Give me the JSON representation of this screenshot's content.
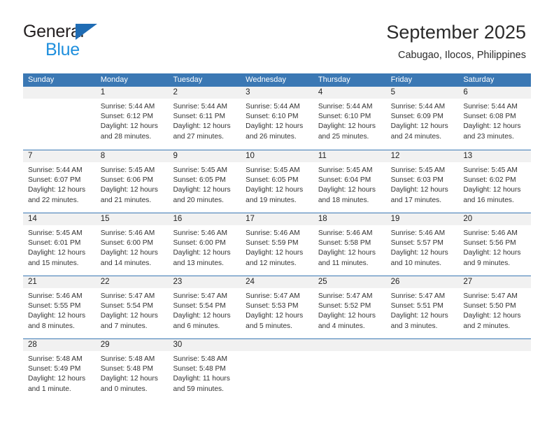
{
  "brand": {
    "name_top": "General",
    "name_bottom": "Blue",
    "triangle_color": "#1f6cb4",
    "blue_color": "#1f8fdd"
  },
  "header": {
    "title": "September 2025",
    "subtitle": "Cabugao, Ilocos, Philippines"
  },
  "theme": {
    "header_blue": "#3b78b4",
    "date_band": "#f1f1f1",
    "text": "#222222"
  },
  "weekdays": [
    "Sunday",
    "Monday",
    "Tuesday",
    "Wednesday",
    "Thursday",
    "Friday",
    "Saturday"
  ],
  "weeks": [
    [
      {
        "empty": true
      },
      {
        "date": "1",
        "sunrise": "Sunrise: 5:44 AM",
        "sunset": "Sunset: 6:12 PM",
        "daylight1": "Daylight: 12 hours",
        "daylight2": "and 28 minutes."
      },
      {
        "date": "2",
        "sunrise": "Sunrise: 5:44 AM",
        "sunset": "Sunset: 6:11 PM",
        "daylight1": "Daylight: 12 hours",
        "daylight2": "and 27 minutes."
      },
      {
        "date": "3",
        "sunrise": "Sunrise: 5:44 AM",
        "sunset": "Sunset: 6:10 PM",
        "daylight1": "Daylight: 12 hours",
        "daylight2": "and 26 minutes."
      },
      {
        "date": "4",
        "sunrise": "Sunrise: 5:44 AM",
        "sunset": "Sunset: 6:10 PM",
        "daylight1": "Daylight: 12 hours",
        "daylight2": "and 25 minutes."
      },
      {
        "date": "5",
        "sunrise": "Sunrise: 5:44 AM",
        "sunset": "Sunset: 6:09 PM",
        "daylight1": "Daylight: 12 hours",
        "daylight2": "and 24 minutes."
      },
      {
        "date": "6",
        "sunrise": "Sunrise: 5:44 AM",
        "sunset": "Sunset: 6:08 PM",
        "daylight1": "Daylight: 12 hours",
        "daylight2": "and 23 minutes."
      }
    ],
    [
      {
        "date": "7",
        "sunrise": "Sunrise: 5:44 AM",
        "sunset": "Sunset: 6:07 PM",
        "daylight1": "Daylight: 12 hours",
        "daylight2": "and 22 minutes."
      },
      {
        "date": "8",
        "sunrise": "Sunrise: 5:45 AM",
        "sunset": "Sunset: 6:06 PM",
        "daylight1": "Daylight: 12 hours",
        "daylight2": "and 21 minutes."
      },
      {
        "date": "9",
        "sunrise": "Sunrise: 5:45 AM",
        "sunset": "Sunset: 6:05 PM",
        "daylight1": "Daylight: 12 hours",
        "daylight2": "and 20 minutes."
      },
      {
        "date": "10",
        "sunrise": "Sunrise: 5:45 AM",
        "sunset": "Sunset: 6:05 PM",
        "daylight1": "Daylight: 12 hours",
        "daylight2": "and 19 minutes."
      },
      {
        "date": "11",
        "sunrise": "Sunrise: 5:45 AM",
        "sunset": "Sunset: 6:04 PM",
        "daylight1": "Daylight: 12 hours",
        "daylight2": "and 18 minutes."
      },
      {
        "date": "12",
        "sunrise": "Sunrise: 5:45 AM",
        "sunset": "Sunset: 6:03 PM",
        "daylight1": "Daylight: 12 hours",
        "daylight2": "and 17 minutes."
      },
      {
        "date": "13",
        "sunrise": "Sunrise: 5:45 AM",
        "sunset": "Sunset: 6:02 PM",
        "daylight1": "Daylight: 12 hours",
        "daylight2": "and 16 minutes."
      }
    ],
    [
      {
        "date": "14",
        "sunrise": "Sunrise: 5:45 AM",
        "sunset": "Sunset: 6:01 PM",
        "daylight1": "Daylight: 12 hours",
        "daylight2": "and 15 minutes."
      },
      {
        "date": "15",
        "sunrise": "Sunrise: 5:46 AM",
        "sunset": "Sunset: 6:00 PM",
        "daylight1": "Daylight: 12 hours",
        "daylight2": "and 14 minutes."
      },
      {
        "date": "16",
        "sunrise": "Sunrise: 5:46 AM",
        "sunset": "Sunset: 6:00 PM",
        "daylight1": "Daylight: 12 hours",
        "daylight2": "and 13 minutes."
      },
      {
        "date": "17",
        "sunrise": "Sunrise: 5:46 AM",
        "sunset": "Sunset: 5:59 PM",
        "daylight1": "Daylight: 12 hours",
        "daylight2": "and 12 minutes."
      },
      {
        "date": "18",
        "sunrise": "Sunrise: 5:46 AM",
        "sunset": "Sunset: 5:58 PM",
        "daylight1": "Daylight: 12 hours",
        "daylight2": "and 11 minutes."
      },
      {
        "date": "19",
        "sunrise": "Sunrise: 5:46 AM",
        "sunset": "Sunset: 5:57 PM",
        "daylight1": "Daylight: 12 hours",
        "daylight2": "and 10 minutes."
      },
      {
        "date": "20",
        "sunrise": "Sunrise: 5:46 AM",
        "sunset": "Sunset: 5:56 PM",
        "daylight1": "Daylight: 12 hours",
        "daylight2": "and 9 minutes."
      }
    ],
    [
      {
        "date": "21",
        "sunrise": "Sunrise: 5:46 AM",
        "sunset": "Sunset: 5:55 PM",
        "daylight1": "Daylight: 12 hours",
        "daylight2": "and 8 minutes."
      },
      {
        "date": "22",
        "sunrise": "Sunrise: 5:47 AM",
        "sunset": "Sunset: 5:54 PM",
        "daylight1": "Daylight: 12 hours",
        "daylight2": "and 7 minutes."
      },
      {
        "date": "23",
        "sunrise": "Sunrise: 5:47 AM",
        "sunset": "Sunset: 5:54 PM",
        "daylight1": "Daylight: 12 hours",
        "daylight2": "and 6 minutes."
      },
      {
        "date": "24",
        "sunrise": "Sunrise: 5:47 AM",
        "sunset": "Sunset: 5:53 PM",
        "daylight1": "Daylight: 12 hours",
        "daylight2": "and 5 minutes."
      },
      {
        "date": "25",
        "sunrise": "Sunrise: 5:47 AM",
        "sunset": "Sunset: 5:52 PM",
        "daylight1": "Daylight: 12 hours",
        "daylight2": "and 4 minutes."
      },
      {
        "date": "26",
        "sunrise": "Sunrise: 5:47 AM",
        "sunset": "Sunset: 5:51 PM",
        "daylight1": "Daylight: 12 hours",
        "daylight2": "and 3 minutes."
      },
      {
        "date": "27",
        "sunrise": "Sunrise: 5:47 AM",
        "sunset": "Sunset: 5:50 PM",
        "daylight1": "Daylight: 12 hours",
        "daylight2": "and 2 minutes."
      }
    ],
    [
      {
        "date": "28",
        "sunrise": "Sunrise: 5:48 AM",
        "sunset": "Sunset: 5:49 PM",
        "daylight1": "Daylight: 12 hours",
        "daylight2": "and 1 minute."
      },
      {
        "date": "29",
        "sunrise": "Sunrise: 5:48 AM",
        "sunset": "Sunset: 5:48 PM",
        "daylight1": "Daylight: 12 hours",
        "daylight2": "and 0 minutes."
      },
      {
        "date": "30",
        "sunrise": "Sunrise: 5:48 AM",
        "sunset": "Sunset: 5:48 PM",
        "daylight1": "Daylight: 11 hours",
        "daylight2": "and 59 minutes."
      },
      {
        "empty": true
      },
      {
        "empty": true
      },
      {
        "empty": true
      },
      {
        "empty": true
      }
    ]
  ]
}
